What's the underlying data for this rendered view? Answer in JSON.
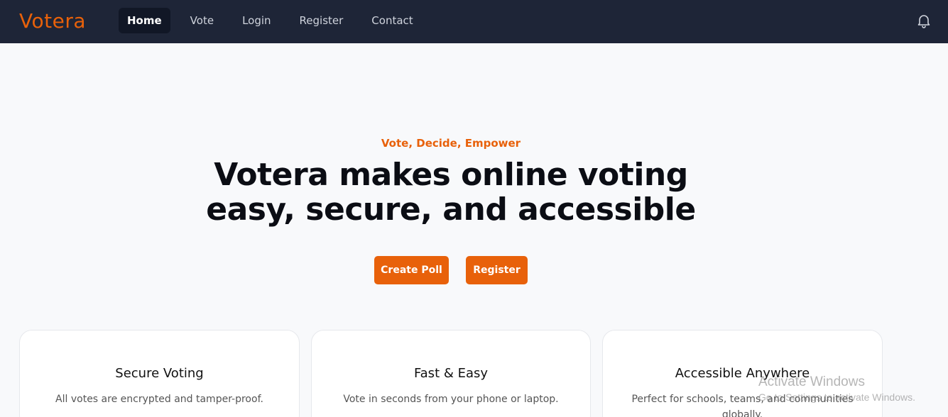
{
  "brand": {
    "name": "Votera",
    "accent_color": "#e8610a",
    "nav_bg": "#1e2537"
  },
  "nav": {
    "items": [
      {
        "label": "Home",
        "active": true
      },
      {
        "label": "Vote",
        "active": false
      },
      {
        "label": "Login",
        "active": false
      },
      {
        "label": "Register",
        "active": false
      },
      {
        "label": "Contact",
        "active": false
      }
    ],
    "notification_icon": "bell-icon"
  },
  "hero": {
    "tagline": "Vote, Decide, Empower",
    "title_line1": "Votera makes online voting",
    "title_line2": "easy, secure, and accessible",
    "create_poll_label": "Create Poll",
    "register_label": "Register"
  },
  "features": [
    {
      "title": "Secure Voting",
      "text": "All votes are encrypted and tamper-proof."
    },
    {
      "title": "Fast & Easy",
      "text": "Vote in seconds from your phone or laptop."
    },
    {
      "title": "Accessible Anywhere",
      "text": "Perfect for schools, teams, and communities globally."
    }
  ],
  "watermark": {
    "title": "Activate Windows",
    "subtitle": "Go to Settings to activate Windows."
  }
}
